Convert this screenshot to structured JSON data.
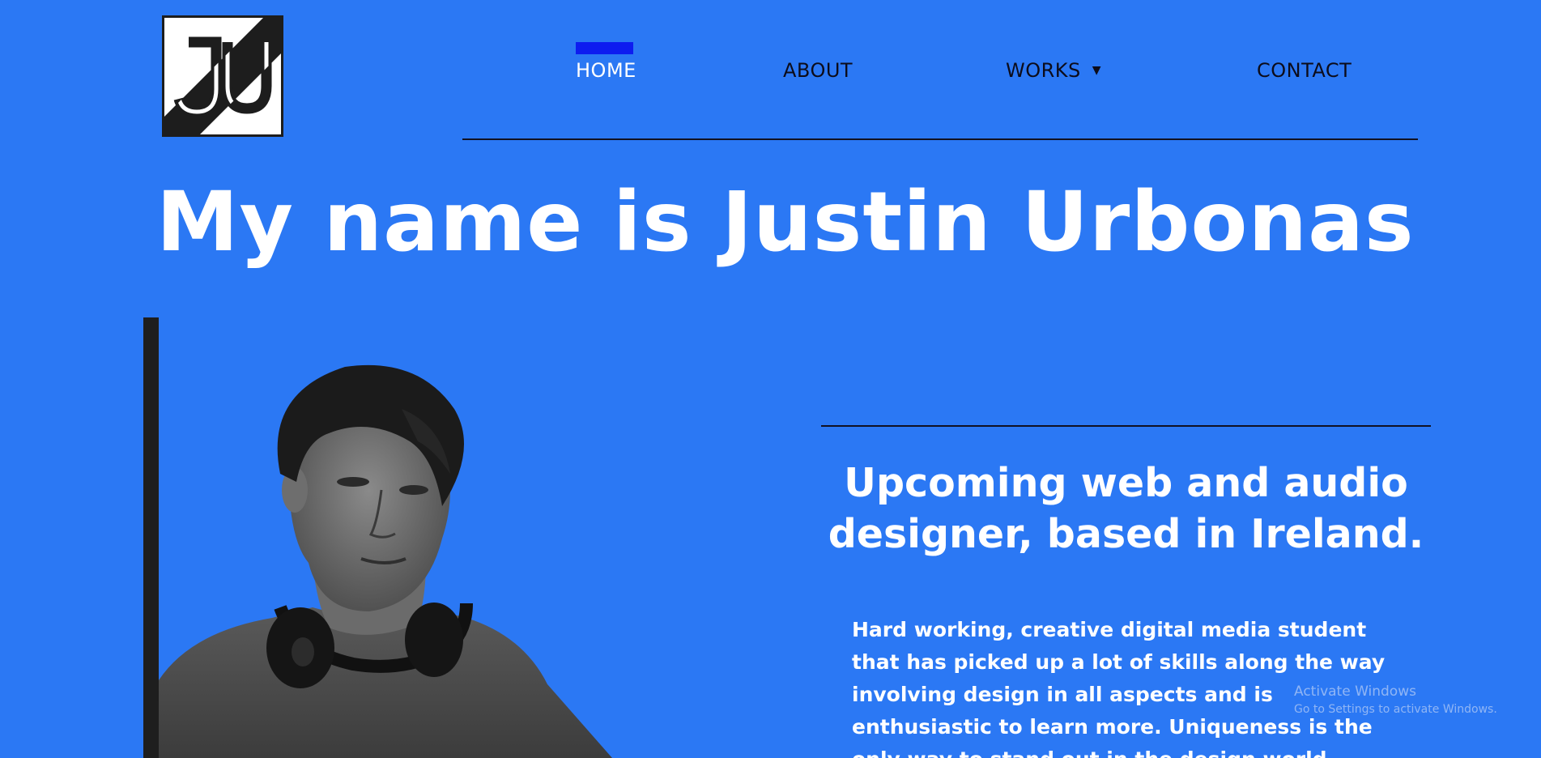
{
  "logo": {
    "text": "JU",
    "icon": "ju-monogram-logo"
  },
  "nav": {
    "items": [
      {
        "label": "HOME",
        "active": true
      },
      {
        "label": "ABOUT",
        "active": false
      },
      {
        "label": "WORKS",
        "active": false,
        "has_dropdown": true
      },
      {
        "label": "CONTACT",
        "active": false
      }
    ],
    "active_indicator_color": "#0d1cf0"
  },
  "hero": {
    "title": "My name is Justin Urbonas"
  },
  "profile": {
    "subtitle": "Upcoming web and audio designer, based in Ireland.",
    "bio": "Hard working, creative digital media student that has picked up a lot of skills along the way involving design in all aspects and is enthusiastic to learn more. Uniqueness is the only way to stand out in the design world."
  },
  "watermark": {
    "title": "Activate Windows",
    "subtitle": "Go to Settings to activate Windows."
  },
  "colors": {
    "background": "#2b78f4",
    "text_light": "#ffffff",
    "text_dark": "#0c0c1a",
    "accent_bar": "#1e1e1e"
  }
}
